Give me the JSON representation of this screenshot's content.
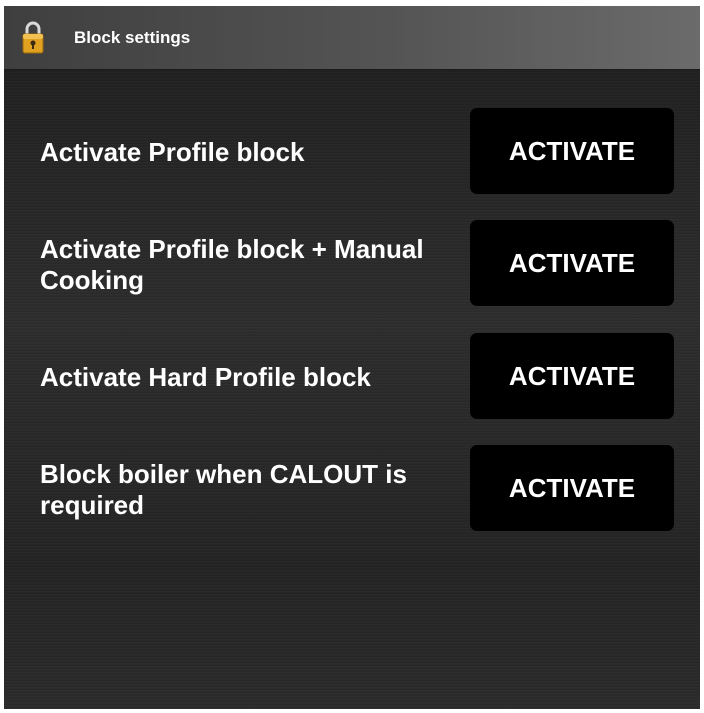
{
  "window": {
    "title": "Block settings",
    "icon": "lock-icon"
  },
  "rows": [
    {
      "label": "Activate Profile block",
      "button": "ACTIVATE"
    },
    {
      "label": "Activate Profile block + Manual Cooking",
      "button": "ACTIVATE"
    },
    {
      "label": "Activate Hard Profile block",
      "button": "ACTIVATE"
    },
    {
      "label": "Block boiler when CALOUT is required",
      "button": "ACTIVATE"
    }
  ],
  "colors": {
    "button_bg": "#000000",
    "text": "#ffffff",
    "lock_body": "#e0a020"
  }
}
